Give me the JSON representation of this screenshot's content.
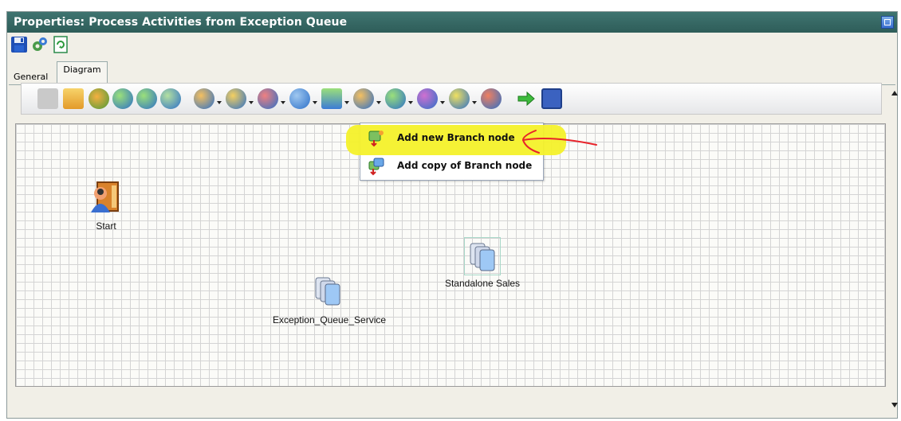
{
  "window": {
    "title": "Properties: Process Activities from Exception Queue"
  },
  "top_icons": [
    {
      "name": "save-icon"
    },
    {
      "name": "settings-gear-icon"
    },
    {
      "name": "refresh-icon"
    }
  ],
  "tabs": [
    {
      "label": "General",
      "active": false
    },
    {
      "label": "Diagram",
      "active": true
    }
  ],
  "toolbar": {
    "buttons": [
      "disabled-icon",
      "add-activity-icon",
      "users-icon",
      "node-icon-1",
      "node-icon-2",
      "node-icon-3",
      "node-dropdown-1",
      "node-dropdown-2",
      "node-dropdown-3",
      "node-dropdown-4",
      "branch-node-dropdown",
      "node-dropdown-6",
      "node-dropdown-7",
      "node-dropdown-8",
      "node-dropdown-9",
      "node-icon-10",
      "go-arrow-icon",
      "grid-icon"
    ]
  },
  "dropdown_menu": {
    "items": [
      {
        "label": "Add new Branch node",
        "highlighted": true
      },
      {
        "label": "Add copy of Branch node",
        "highlighted": false
      }
    ]
  },
  "diagram": {
    "nodes": [
      {
        "label": "Start",
        "icon": "start-node-icon"
      },
      {
        "label": "Standalone Sales",
        "icon": "service-node-icon",
        "selected": true
      },
      {
        "label": "Exception_Queue_Service",
        "icon": "service-node-icon",
        "selected": false
      }
    ]
  },
  "colors": {
    "titlebar": "#2e5d59",
    "highlight": "#f4f12a",
    "annotation_arrow": "#e8232a",
    "grid_line": "#d4d4d4"
  }
}
